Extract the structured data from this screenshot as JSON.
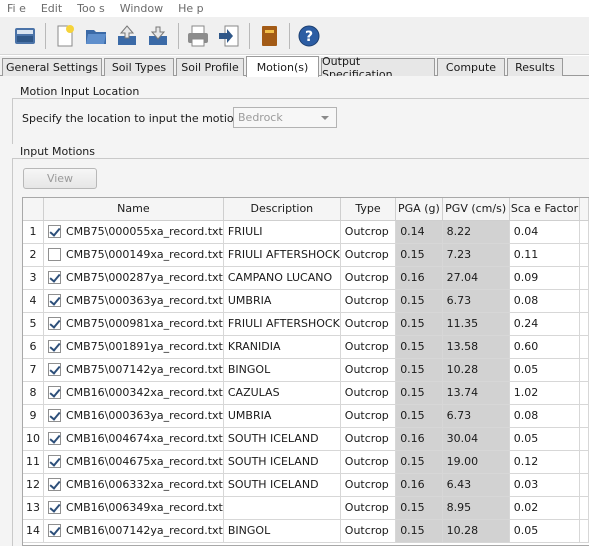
{
  "menu": [
    "Fi e",
    "Edit",
    "Too s",
    "Window",
    "He p"
  ],
  "toolbar": {
    "icons": [
      "disk-stack-icon",
      "new-file-icon",
      "open-folder-icon",
      "import-icon",
      "export-icon",
      "print-icon",
      "run-icon",
      "book-icon",
      "help-icon"
    ]
  },
  "tabs": [
    "General Settings",
    "Soil Types",
    "Soil Profile",
    "Motion(s)",
    "Output Specification",
    "Compute",
    "Results"
  ],
  "active_tab": "Motion(s)",
  "motion_location": {
    "title": "Motion Input Location",
    "label": "Specify the location to input the motion(s):",
    "value": "Bedrock"
  },
  "input_motions": {
    "title": "Input Motions",
    "view_label": "View",
    "columns": [
      "Name",
      "Description",
      "Type",
      "PGA (g)",
      "PGV (cm/s)",
      "Sca e Factor"
    ],
    "rows": [
      {
        "idx": "1",
        "checked": true,
        "name": "CMB75\\000055xa_record.txt",
        "desc": "FRIULI",
        "type": "Outcrop",
        "pga": "0.14",
        "pgv": "8.22",
        "scale": "0.04"
      },
      {
        "idx": "2",
        "checked": false,
        "name": "CMB75\\000149xa_record.txt",
        "desc": "FRIULI AFTERSHOCK",
        "type": "Outcrop",
        "pga": "0.15",
        "pgv": "7.23",
        "scale": "0.11"
      },
      {
        "idx": "3",
        "checked": true,
        "name": "CMB75\\000287ya_record.txt",
        "desc": "CAMPANO LUCANO",
        "type": "Outcrop",
        "pga": "0.16",
        "pgv": "27.04",
        "scale": "0.09"
      },
      {
        "idx": "4",
        "checked": true,
        "name": "CMB75\\000363ya_record.txt",
        "desc": "UMBRIA",
        "type": "Outcrop",
        "pga": "0.15",
        "pgv": "6.73",
        "scale": "0.08"
      },
      {
        "idx": "5",
        "checked": true,
        "name": "CMB75\\000981xa_record.txt",
        "desc": "FRIULI AFTERSHOCK",
        "type": "Outcrop",
        "pga": "0.15",
        "pgv": "11.35",
        "scale": "0.24"
      },
      {
        "idx": "6",
        "checked": true,
        "name": "CMB75\\001891ya_record.txt",
        "desc": "KRANIDIA",
        "type": "Outcrop",
        "pga": "0.15",
        "pgv": "13.58",
        "scale": "0.60"
      },
      {
        "idx": "7",
        "checked": true,
        "name": "CMB75\\007142ya_record.txt",
        "desc": "BINGOL",
        "type": "Outcrop",
        "pga": "0.15",
        "pgv": "10.28",
        "scale": "0.05"
      },
      {
        "idx": "8",
        "checked": true,
        "name": "CMB16\\000342xa_record.txt",
        "desc": "CAZULAS",
        "type": "Outcrop",
        "pga": "0.15",
        "pgv": "13.74",
        "scale": "1.02"
      },
      {
        "idx": "9",
        "checked": true,
        "name": "CMB16\\000363ya_record.txt",
        "desc": "UMBRIA",
        "type": "Outcrop",
        "pga": "0.15",
        "pgv": "6.73",
        "scale": "0.08"
      },
      {
        "idx": "10",
        "checked": true,
        "name": "CMB16\\004674xa_record.txt",
        "desc": "SOUTH ICELAND",
        "type": "Outcrop",
        "pga": "0.16",
        "pgv": "30.04",
        "scale": "0.05"
      },
      {
        "idx": "11",
        "checked": true,
        "name": "CMB16\\004675xa_record.txt",
        "desc": "SOUTH ICELAND",
        "type": "Outcrop",
        "pga": "0.15",
        "pgv": "19.00",
        "scale": "0.12"
      },
      {
        "idx": "12",
        "checked": true,
        "name": "CMB16\\006332xa_record.txt",
        "desc": "SOUTH ICELAND",
        "type": "Outcrop",
        "pga": "0.16",
        "pgv": "6.43",
        "scale": "0.03"
      },
      {
        "idx": "13",
        "checked": true,
        "name": "CMB16\\006349xa_record.txt",
        "desc": "",
        "type": "Outcrop",
        "pga": "0.15",
        "pgv": "8.95",
        "scale": "0.02"
      },
      {
        "idx": "14",
        "checked": true,
        "name": "CMB16\\007142ya_record.txt",
        "desc": "BINGOL",
        "type": "Outcrop",
        "pga": "0.15",
        "pgv": "10.28",
        "scale": "0.05"
      }
    ]
  }
}
